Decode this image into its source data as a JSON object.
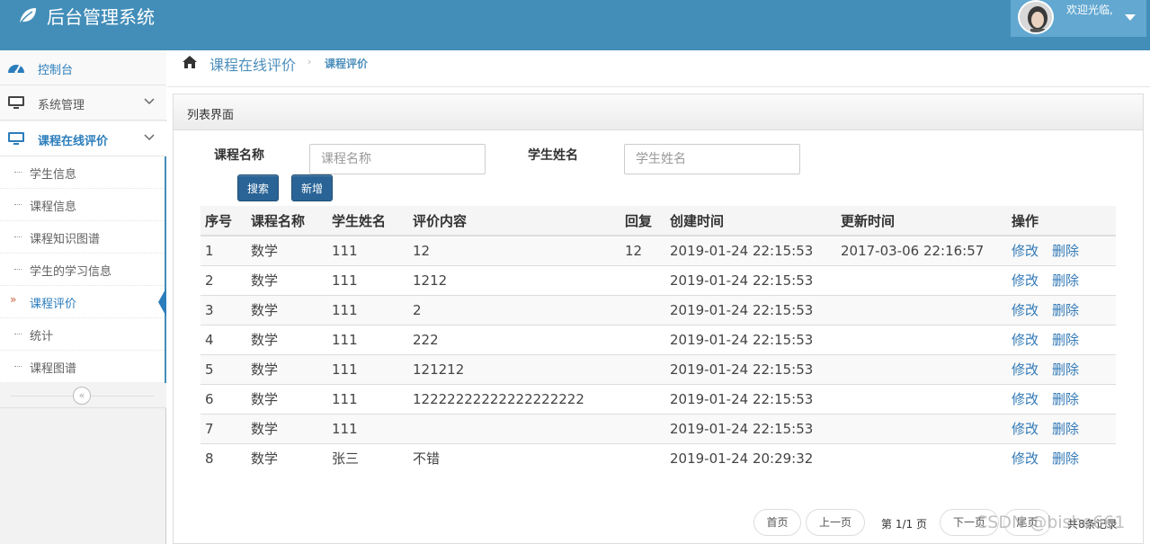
{
  "header": {
    "title": "后台管理系统",
    "welcome": "欢迎光临,"
  },
  "sidebar": {
    "items": [
      {
        "label": "控制台"
      },
      {
        "label": "系统管理"
      },
      {
        "label": "课程在线评价"
      }
    ],
    "sub_items": [
      {
        "label": "学生信息"
      },
      {
        "label": "课程信息"
      },
      {
        "label": "课程知识图谱"
      },
      {
        "label": "学生的学习信息"
      },
      {
        "label": "课程评价",
        "marker": "»"
      },
      {
        "label": "统计"
      },
      {
        "label": "课程图谱"
      }
    ],
    "collapse_glyph": "«"
  },
  "breadcrumb": {
    "main": "课程在线评价",
    "separator": "›",
    "current": "课程评价"
  },
  "panel": {
    "title": "列表界面"
  },
  "search": {
    "course_label": "课程名称",
    "course_placeholder": "课程名称",
    "student_label": "学生姓名",
    "student_placeholder": "学生姓名",
    "search_btn": "搜索",
    "add_btn": "新增"
  },
  "table": {
    "headers": [
      "序号",
      "课程名称",
      "学生姓名",
      "评价内容",
      "回复",
      "创建时间",
      "更新时间",
      "操作"
    ],
    "rows": [
      [
        "1",
        "数学",
        "111",
        "12",
        "12",
        "2019-01-24 22:15:53",
        "2017-03-06 22:16:57"
      ],
      [
        "2",
        "数学",
        "111",
        "1212",
        "",
        "2019-01-24 22:15:53",
        ""
      ],
      [
        "3",
        "数学",
        "111",
        "2",
        "",
        "2019-01-24 22:15:53",
        ""
      ],
      [
        "4",
        "数学",
        "111",
        "222",
        "",
        "2019-01-24 22:15:53",
        ""
      ],
      [
        "5",
        "数学",
        "111",
        "121212",
        "",
        "2019-01-24 22:15:53",
        ""
      ],
      [
        "6",
        "数学",
        "111",
        "12222222222222222222",
        "",
        "2019-01-24 22:15:53",
        ""
      ],
      [
        "7",
        "数学",
        "111",
        "",
        "",
        "2019-01-24 22:15:53",
        ""
      ],
      [
        "8",
        "数学",
        "张三",
        "不错",
        "",
        "2019-01-24 20:29:32",
        ""
      ]
    ],
    "edit_label": "修改",
    "delete_label": "删除"
  },
  "pagination": {
    "first": "首页",
    "prev": "上一页",
    "page_info": "第 1/1 页",
    "next": "下一页",
    "last": "尾页",
    "total": "共8条记录"
  },
  "watermark": "CSDN @bishe661",
  "colors": {
    "header_bg": "#438eb9",
    "accent": "#2b7dbc",
    "button": "#2a6496"
  }
}
